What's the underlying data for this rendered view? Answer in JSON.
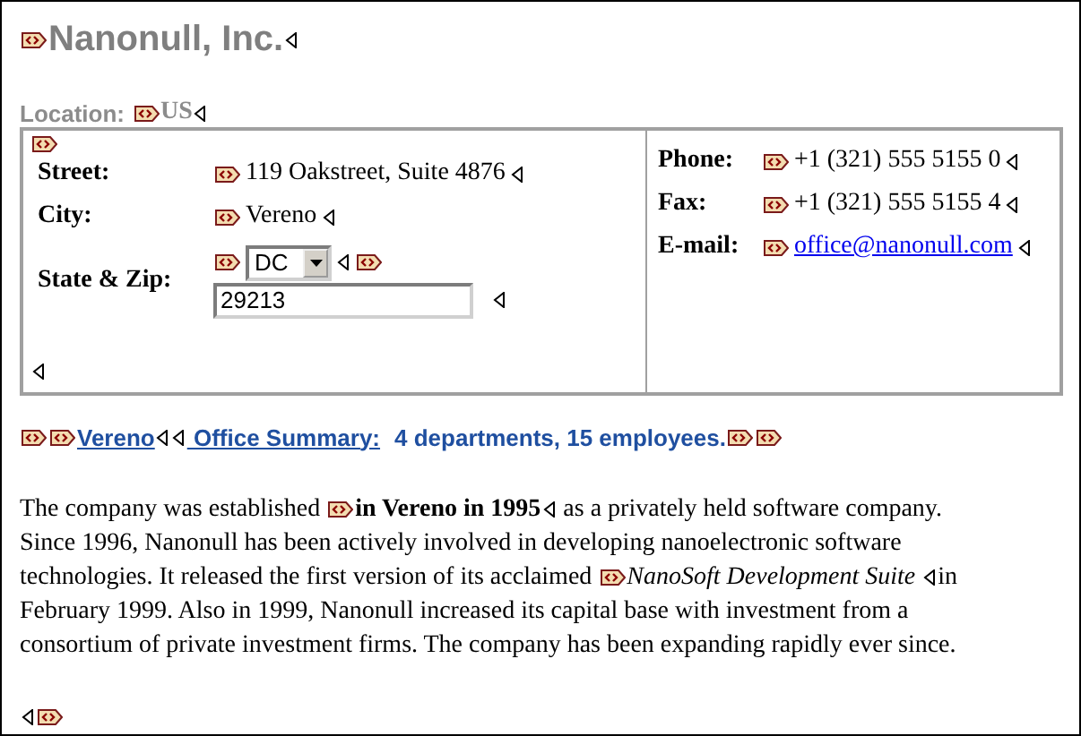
{
  "company": {
    "name": "Nanonull, Inc."
  },
  "location": {
    "label": "Location:",
    "value": "US"
  },
  "address": [
    {
      "label": "Street:",
      "kind": "text",
      "value": "119 Oakstreet, Suite 4876"
    },
    {
      "label": "City:",
      "kind": "text",
      "value": "Vereno"
    },
    {
      "label": "State & Zip:",
      "kind": "state_zip",
      "state": "DC",
      "zip": "29213"
    }
  ],
  "contact": [
    {
      "label": "Phone:",
      "kind": "text",
      "value": "+1 (321) 555 5155 0"
    },
    {
      "label": "Fax:",
      "kind": "text",
      "value": "+1 (321) 555 5155 4"
    },
    {
      "label": "E-mail:",
      "kind": "link",
      "value": "office@nanonull.com"
    }
  ],
  "summary": {
    "city": "Vereno",
    "label": " Office Summary:",
    "text": "4 departments, 15 employees."
  },
  "paragraph": [
    [
      {
        "kind": "plain",
        "text": "The company was established "
      },
      {
        "kind": "bold",
        "text": "in Vereno in 1995"
      },
      {
        "kind": "plain",
        "text": " as a privately held software company."
      }
    ],
    [
      {
        "kind": "plain",
        "text": "Since 1996, Nanonull has been actively involved in developing nanoelectronic software"
      }
    ],
    [
      {
        "kind": "plain",
        "text": "technologies. It released the first version of its acclaimed "
      },
      {
        "kind": "italic",
        "text": "NanoSoft Development Suite "
      },
      {
        "kind": "plain",
        "text": "in"
      }
    ],
    [
      {
        "kind": "plain",
        "text": "February 1999. Also in 1999, Nanonull increased its capital base with investment from a"
      }
    ],
    [
      {
        "kind": "plain",
        "text": "consortium of private investment firms. The company has been expanding rapidly ever since."
      }
    ]
  ]
}
